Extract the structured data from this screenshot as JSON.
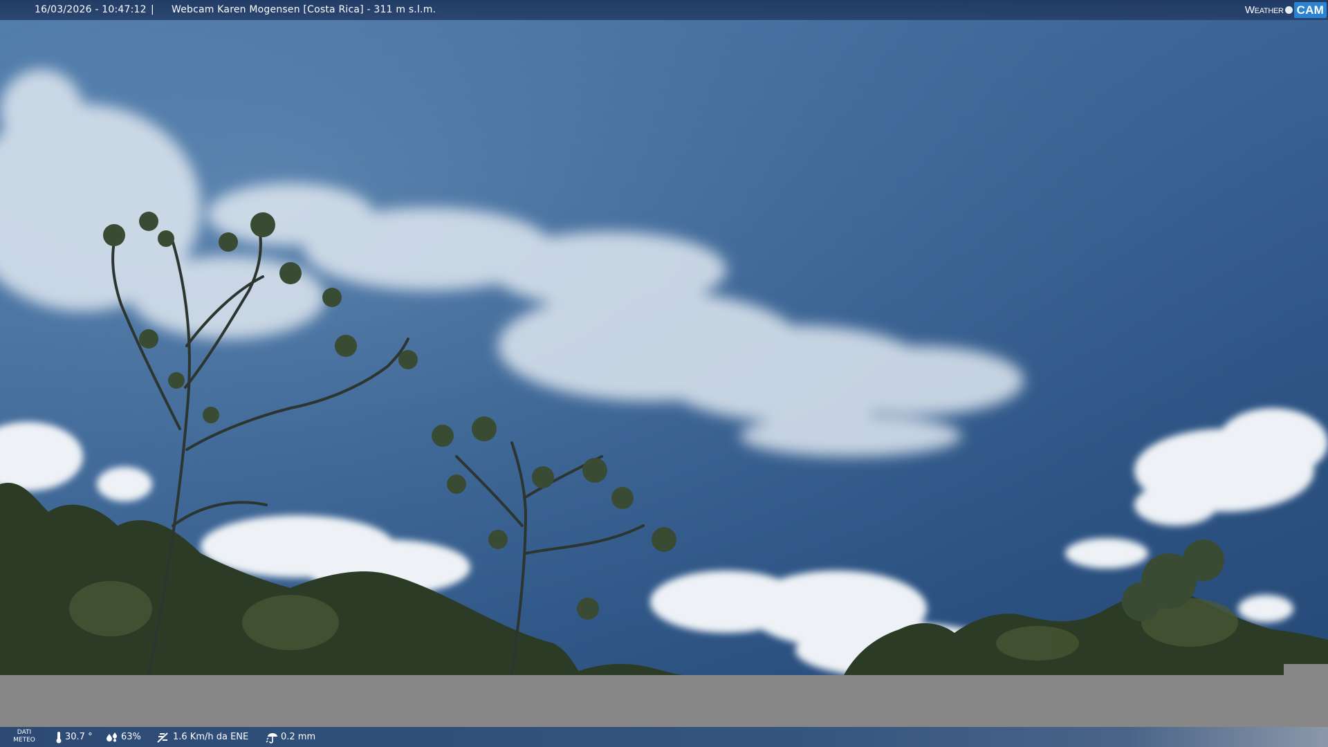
{
  "header": {
    "timestamp": "16/03/2026 - 10:47:12",
    "separator": "|",
    "title": "Webcam Karen Mogensen [Costa Rica] - 311 m s.l.m."
  },
  "logo": {
    "part1": "Weather",
    "part2": "CAM"
  },
  "weather_bar": {
    "label_line1": "DATI",
    "label_line2": "METEO",
    "temperature": "30.7 °",
    "humidity": "63%",
    "wind": "1.6 Km/h da ENE",
    "rain": "0.2 mm"
  },
  "icons": {
    "temperature": "thermometer-icon",
    "humidity": "humidity-drops-icon",
    "wind": "wind-icon",
    "rain": "rain-gauge-icon"
  },
  "colors": {
    "sky_top": "#2f5686",
    "cloud": "#e9eef4",
    "foliage": "#2b3b25",
    "gray_strip": "#878787",
    "logo_accent": "#2a84d2"
  }
}
